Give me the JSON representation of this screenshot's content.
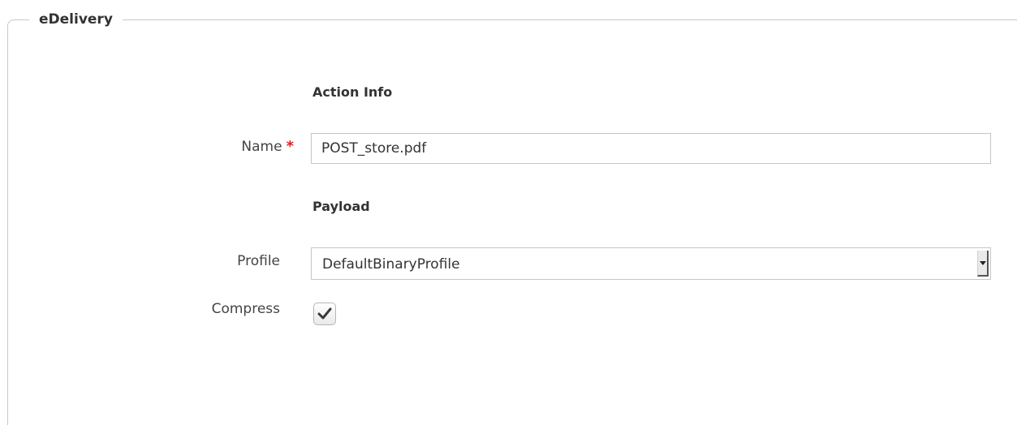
{
  "panel": {
    "legend": "eDelivery"
  },
  "action_info": {
    "title": "Action Info",
    "name_label": "Name",
    "required_marker": "*",
    "name_value": "POST_store.pdf"
  },
  "payload": {
    "title": "Payload",
    "profile_label": "Profile",
    "profile_value": "DefaultBinaryProfile",
    "compress_label": "Compress",
    "compress_checked": true
  },
  "icons": {
    "checkbox": "check-icon",
    "select": "dropdown-arrow-icon"
  }
}
